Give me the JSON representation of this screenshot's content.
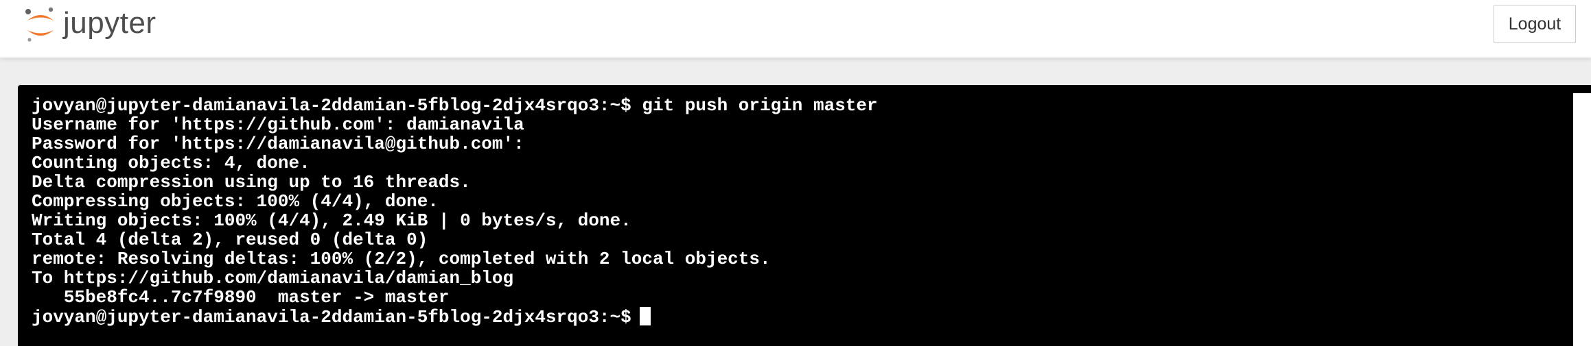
{
  "header": {
    "logo_text": "jupyter",
    "logout_label": "Logout",
    "colors": {
      "logo_orange": "#f37726",
      "logo_gray": "#616262"
    }
  },
  "terminal": {
    "lines": [
      "jovyan@jupyter-damianavila-2ddamian-5fblog-2djx4srqo3:~$ git push origin master",
      "Username for 'https://github.com': damianavila",
      "Password for 'https://damianavila@github.com':",
      "Counting objects: 4, done.",
      "Delta compression using up to 16 threads.",
      "Compressing objects: 100% (4/4), done.",
      "Writing objects: 100% (4/4), 2.49 KiB | 0 bytes/s, done.",
      "Total 4 (delta 2), reused 0 (delta 0)",
      "remote: Resolving deltas: 100% (2/2), completed with 2 local objects.",
      "To https://github.com/damianavila/damian_blog",
      "   55be8fc4..7c7f9890  master -> master"
    ],
    "prompt": "jovyan@jupyter-damianavila-2ddamian-5fblog-2djx4srqo3:~$",
    "colors": {
      "background": "#000000",
      "foreground": "#ffffff"
    }
  }
}
